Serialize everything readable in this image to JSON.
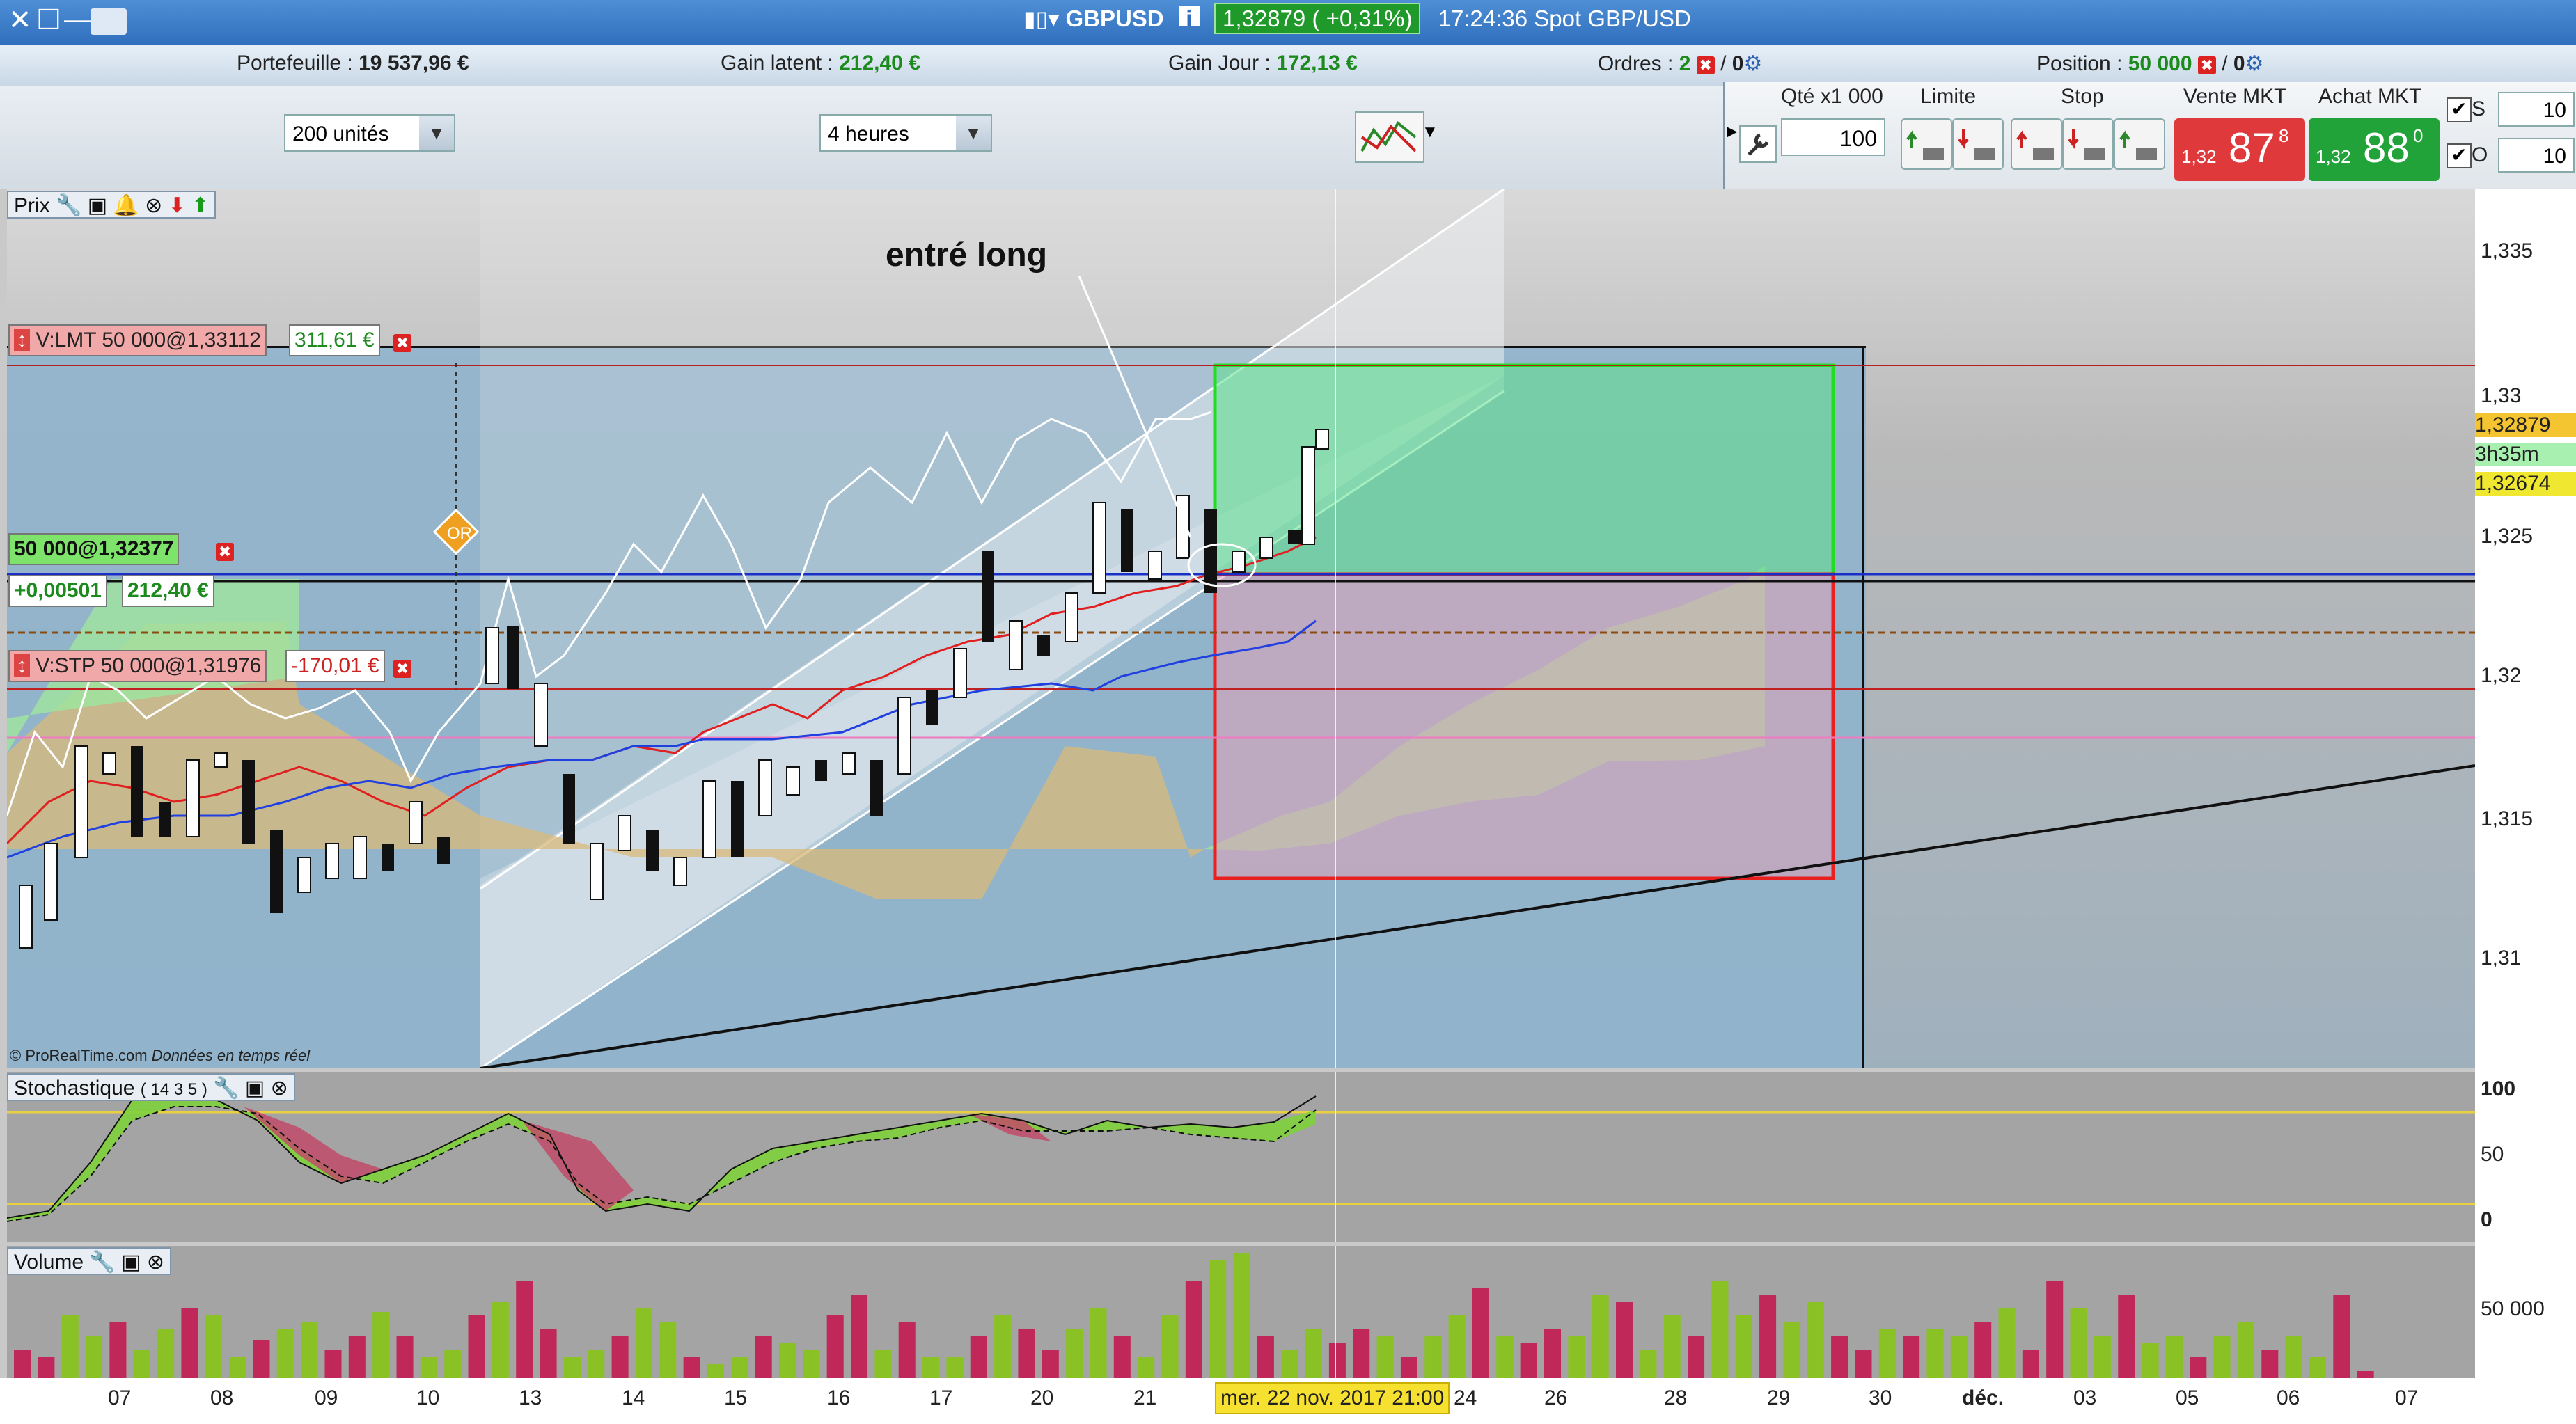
{
  "window": {
    "symbol": "GBPUSD",
    "price": "1,32879",
    "change": "( +0,31%)",
    "time_label": "17:24:36 Spot GBP/USD"
  },
  "infobar": {
    "portefeuille_label": "Portefeuille :",
    "portefeuille_value": "19 537,96 €",
    "gain_latent_label": "Gain latent :",
    "gain_latent_value": "212,40 €",
    "gain_jour_label": "Gain Jour :",
    "gain_jour_value": "172,13 €",
    "ordres_label": "Ordres :",
    "ordres_value": "2",
    "ordres_zero": "0",
    "position_label": "Position :",
    "position_value": "50 000",
    "position_zero": "0"
  },
  "toolbar": {
    "units": "200 unités",
    "period": "4 heures"
  },
  "order_panel": {
    "qty_label": "Qté x1 000",
    "qty_value": "100",
    "limite_label": "Limite",
    "stop_label": "Stop",
    "vente_label": "Vente MKT",
    "achat_label": "Achat MKT",
    "vente_small": "1,32",
    "vente_big": "87",
    "vente_sup": "8",
    "achat_small": "1,32",
    "achat_big": "88",
    "achat_sup": "0",
    "s_label": "S",
    "s_value": "10",
    "o_label": "O",
    "o_value": "10"
  },
  "price_panel": {
    "label": "Prix",
    "annotation": "entré long",
    "order_limit": "V:LMT 50 000@1,33112",
    "order_limit_gain": "311,61 €",
    "position": "50 000@1,32377",
    "position_diff": "+0,00501",
    "position_gain": "212,40 €",
    "order_stop": "V:STP 50 000@1,31976",
    "order_stop_loss": "-170,01 €",
    "or_badge": "OR",
    "copyright": "© ProRealTime.com",
    "realtime": "Données en temps réel"
  },
  "price_axis": {
    "ticks": [
      "1,335",
      "1,33",
      "1,325",
      "1,32",
      "1,315",
      "1,31"
    ],
    "current_price": "1,32879",
    "countdown": "3h35m",
    "position_price": "1,32674"
  },
  "stoch_panel": {
    "label": "Stochastique",
    "params": "( 14 3 5 )",
    "ticks": [
      "100",
      "50",
      "0"
    ]
  },
  "volume_panel": {
    "label": "Volume",
    "tick": "50 000"
  },
  "x_axis": {
    "labels": [
      "07",
      "08",
      "09",
      "10",
      "13",
      "14",
      "15",
      "16",
      "17",
      "20",
      "21",
      "24",
      "26",
      "28",
      "29",
      "30",
      "déc.",
      "03",
      "05",
      "06",
      "07"
    ],
    "cursor_date": "mer. 22 nov. 2017 21:00"
  },
  "colors": {
    "title_bar": "#3a7cc8",
    "sell": "#e0393c",
    "buy": "#22a33a",
    "chart_bg": "#8fb4cc",
    "kumo_bull": "#9fe3a0",
    "kumo_bear": "#e8c08a"
  }
}
